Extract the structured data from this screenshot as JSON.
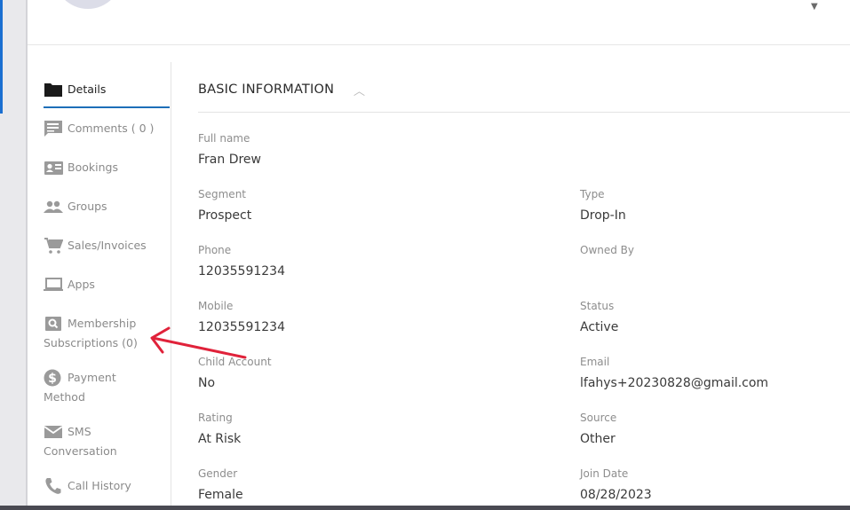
{
  "sidebar": {
    "items": [
      {
        "label": "Details",
        "icon": "folder-icon"
      },
      {
        "label": "Comments ( 0 )",
        "icon": "comment-icon"
      },
      {
        "label": "Bookings",
        "icon": "contact-card-icon"
      },
      {
        "label": "Groups",
        "icon": "people-icon"
      },
      {
        "label": "Sales/Invoices",
        "icon": "cart-icon"
      },
      {
        "label": "Apps",
        "icon": "laptop-icon"
      },
      {
        "label_line1": "Membership",
        "label_line2": "Subscriptions (0)",
        "icon": "search-box-icon"
      },
      {
        "label_line1": "Payment",
        "label_line2": "Method",
        "icon": "dollar-icon"
      },
      {
        "label_line1": "SMS",
        "label_line2": "Conversation",
        "icon": "envelope-icon"
      },
      {
        "label": "Call History",
        "icon": "phone-icon"
      }
    ]
  },
  "main": {
    "section_title": "BASIC INFORMATION",
    "fields": {
      "full_name": {
        "label": "Full name",
        "value": "Fran Drew"
      },
      "segment": {
        "label": "Segment",
        "value": "Prospect"
      },
      "type": {
        "label": "Type",
        "value": "Drop-In"
      },
      "phone": {
        "label": "Phone",
        "value": "12035591234"
      },
      "owned_by": {
        "label": "Owned By",
        "value": ""
      },
      "mobile": {
        "label": "Mobile",
        "value": "12035591234"
      },
      "status": {
        "label": "Status",
        "value": "Active"
      },
      "child_account": {
        "label": "Child Account",
        "value": "No"
      },
      "email": {
        "label": "Email",
        "value": "lfahys+20230828@gmail.com"
      },
      "rating": {
        "label": "Rating",
        "value": "At Risk"
      },
      "source": {
        "label": "Source",
        "value": "Other"
      },
      "gender": {
        "label": "Gender",
        "value": "Female"
      },
      "join_date": {
        "label": "Join Date",
        "value": "08/28/2023"
      }
    }
  },
  "colors": {
    "accent_underline": "#1d6fb8",
    "annotation_arrow": "#e0223a",
    "icon_gray": "#9a9a9a"
  }
}
